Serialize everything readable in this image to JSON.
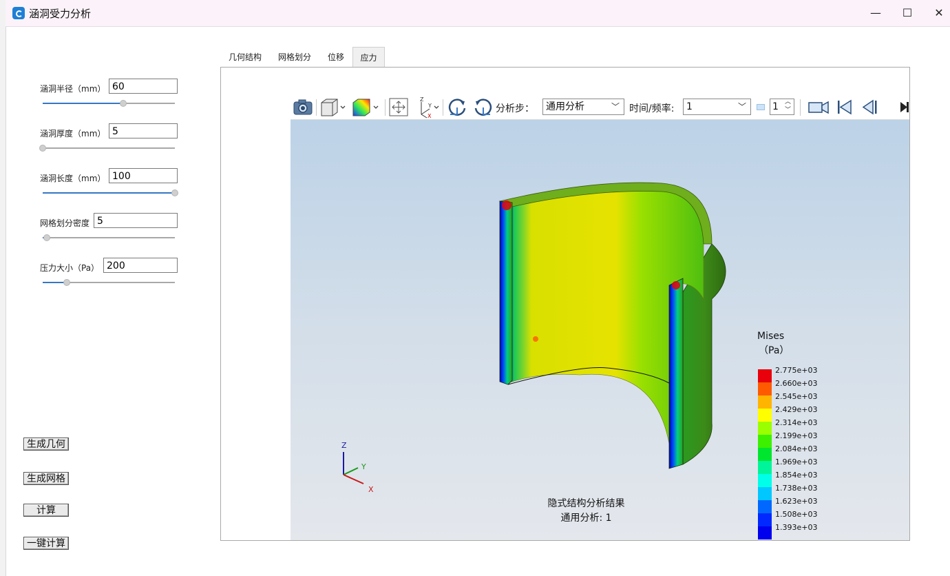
{
  "window": {
    "title": "涵洞受力分析",
    "minimize": "—",
    "maximize": "☐",
    "close": "✕"
  },
  "params": [
    {
      "label": "涵洞半径（mm）",
      "value": "60",
      "slider": 0.61
    },
    {
      "label": "涵洞厚度（mm）",
      "value": "5",
      "slider": 0.0
    },
    {
      "label": "涵洞长度（mm）",
      "value": "100",
      "slider": 1.0
    },
    {
      "label": "网格划分密度",
      "value": "5",
      "slider": 0.03
    },
    {
      "label": "压力大小（Pa）",
      "value": "200",
      "slider": 0.18
    }
  ],
  "actions": {
    "gen_geometry": "生成几何",
    "gen_mesh": "生成网格",
    "compute": "计算",
    "one_click": "一键计算"
  },
  "tabs": [
    "几何结构",
    "网格划分",
    "位移",
    "应力"
  ],
  "active_tab": "应力",
  "toolbar": {
    "step_label": "分析步：",
    "step_value": "通用分析",
    "time_label": "时间/频率:",
    "time_value": "1",
    "spin_value": "1"
  },
  "legend": {
    "title": "Mises",
    "unit": "（Pa）",
    "levels": [
      "2.775e+03",
      "2.660e+03",
      "2.545e+03",
      "2.429e+03",
      "2.314e+03",
      "2.199e+03",
      "2.084e+03",
      "1.969e+03",
      "1.854e+03",
      "1.738e+03",
      "1.623e+03",
      "1.508e+03",
      "1.393e+03"
    ],
    "colors": [
      "#e8000b",
      "#ff5a00",
      "#ffb400",
      "#ffff00",
      "#9aff00",
      "#3cf000",
      "#00e62e",
      "#00f59a",
      "#00ffe8",
      "#00c8ff",
      "#0068ff",
      "#0028ff",
      "#0000ee"
    ]
  },
  "axes": {
    "z": "Z",
    "y": "Y",
    "x": "X"
  },
  "caption": {
    "line1": "隐式结构分析结果",
    "line2": "通用分析: 1"
  }
}
